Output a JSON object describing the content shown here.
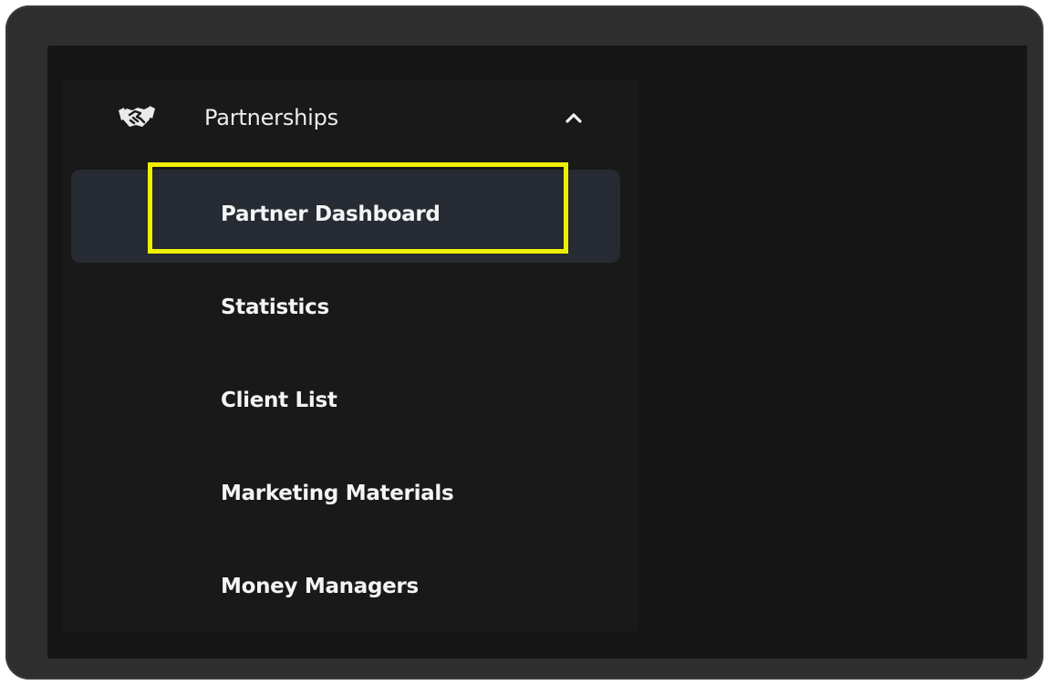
{
  "sidebar": {
    "section": {
      "label": "Partnerships",
      "icon": "handshake-icon",
      "expanded": true,
      "toggle_icon": "chevron-up-icon"
    },
    "items": [
      {
        "label": "Partner Dashboard",
        "active": true,
        "highlighted": true
      },
      {
        "label": "Statistics",
        "active": false
      },
      {
        "label": "Client List",
        "active": false
      },
      {
        "label": "Marketing Materials",
        "active": false
      },
      {
        "label": "Money Managers",
        "active": false
      }
    ]
  },
  "colors": {
    "screen_background": "#151515",
    "sidebar_background": "#191919",
    "active_item_background": "#262b34",
    "highlight_border": "#eef000",
    "text": "#f4f4f4"
  }
}
